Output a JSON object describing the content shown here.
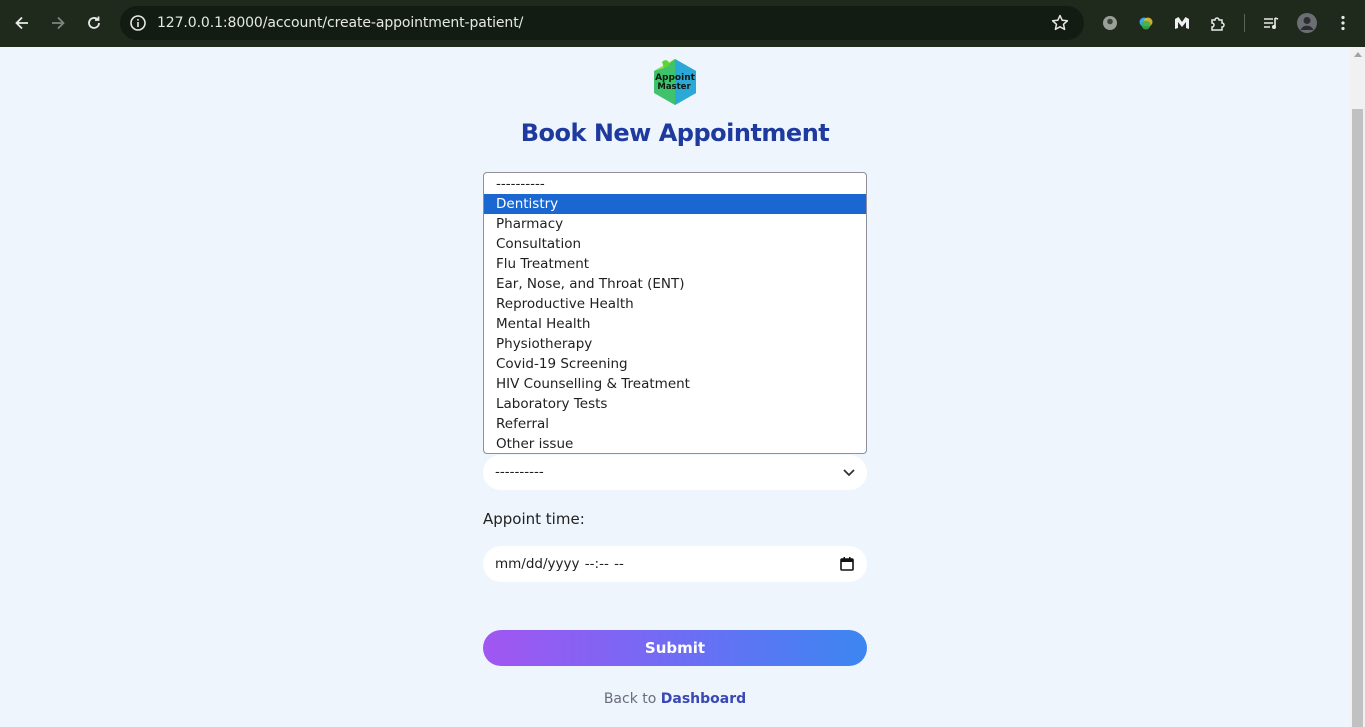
{
  "browser": {
    "url": "127.0.0.1:8000/account/create-appointment-patient/",
    "icons": [
      "back-arrow-icon",
      "forward-arrow-icon",
      "reload-icon",
      "site-info-icon",
      "bookmark-star-icon",
      "extension-icon",
      "menu-dots-icon"
    ]
  },
  "page": {
    "logo_text_line1": "Appoint",
    "logo_text_line2": "Master",
    "title": "Book New Appointment",
    "service_list": {
      "options": [
        "----------",
        "Dentistry",
        "Pharmacy",
        "Consultation",
        "Flu Treatment",
        "Ear, Nose, and Throat (ENT)",
        "Reproductive Health",
        "Mental Health",
        "Physiotherapy",
        "Covid-19 Screening",
        "HIV Counselling & Treatment",
        "Laboratory Tests",
        "Referral",
        "Other issue"
      ],
      "selected": "Dentistry"
    },
    "second_select_value": "----------",
    "appoint_time_label": "Appoint time:",
    "appoint_time_placeholder": "mm/dd/yyyy --:-- --",
    "submit_label": "Submit",
    "back_prefix": "Back to",
    "back_link": "Dashboard"
  },
  "colors": {
    "title": "#1e3a9e",
    "selected_option": "#1a67d2",
    "submit_gradient_start": "#a256f2",
    "submit_gradient_end": "#3c86f2",
    "link": "#3a47b5",
    "background": "#eef5fd"
  }
}
